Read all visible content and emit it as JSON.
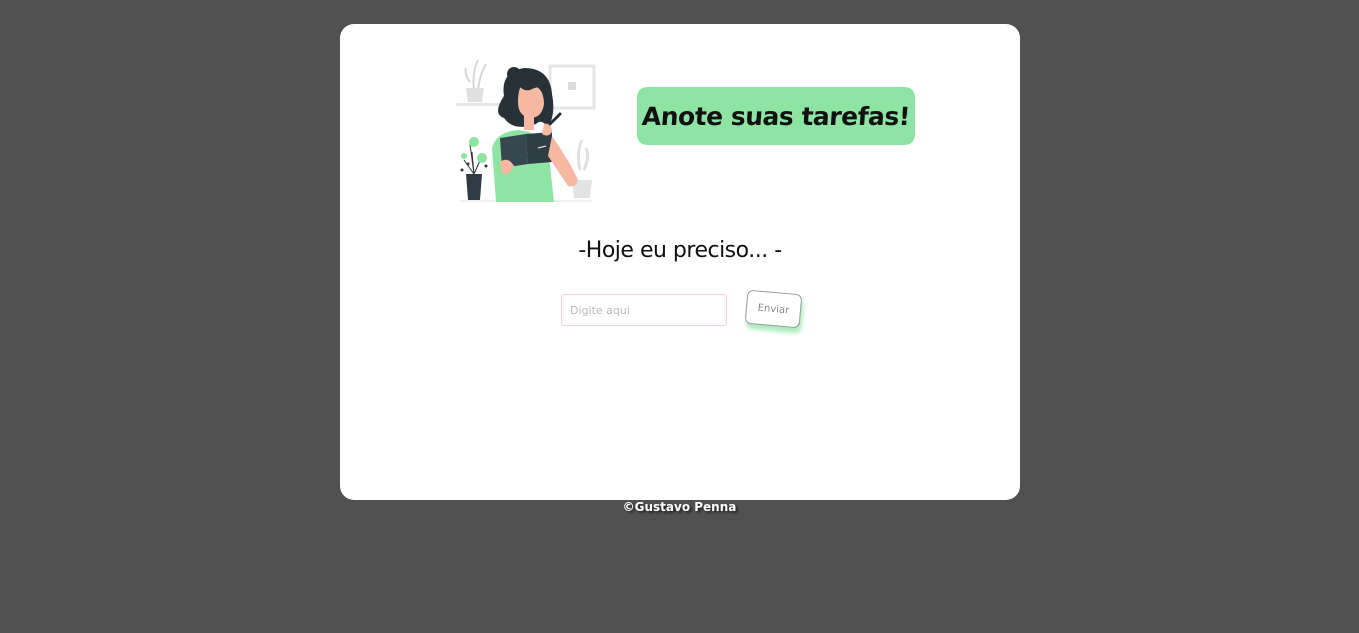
{
  "header": {
    "title": "Anote suas tarefas!",
    "illustration_icon": "woman-writing-notebook-illustration"
  },
  "main": {
    "subtitle": "-Hoje eu preciso... -",
    "input": {
      "placeholder": "Digite aqui",
      "value": ""
    },
    "send_label": "Enviar"
  },
  "footer": {
    "credit": "©Gustavo Penna"
  },
  "colors": {
    "background": "#515151",
    "card": "#ffffff",
    "accent": "#8ee4a3",
    "input_border": "#f5d0d8"
  }
}
